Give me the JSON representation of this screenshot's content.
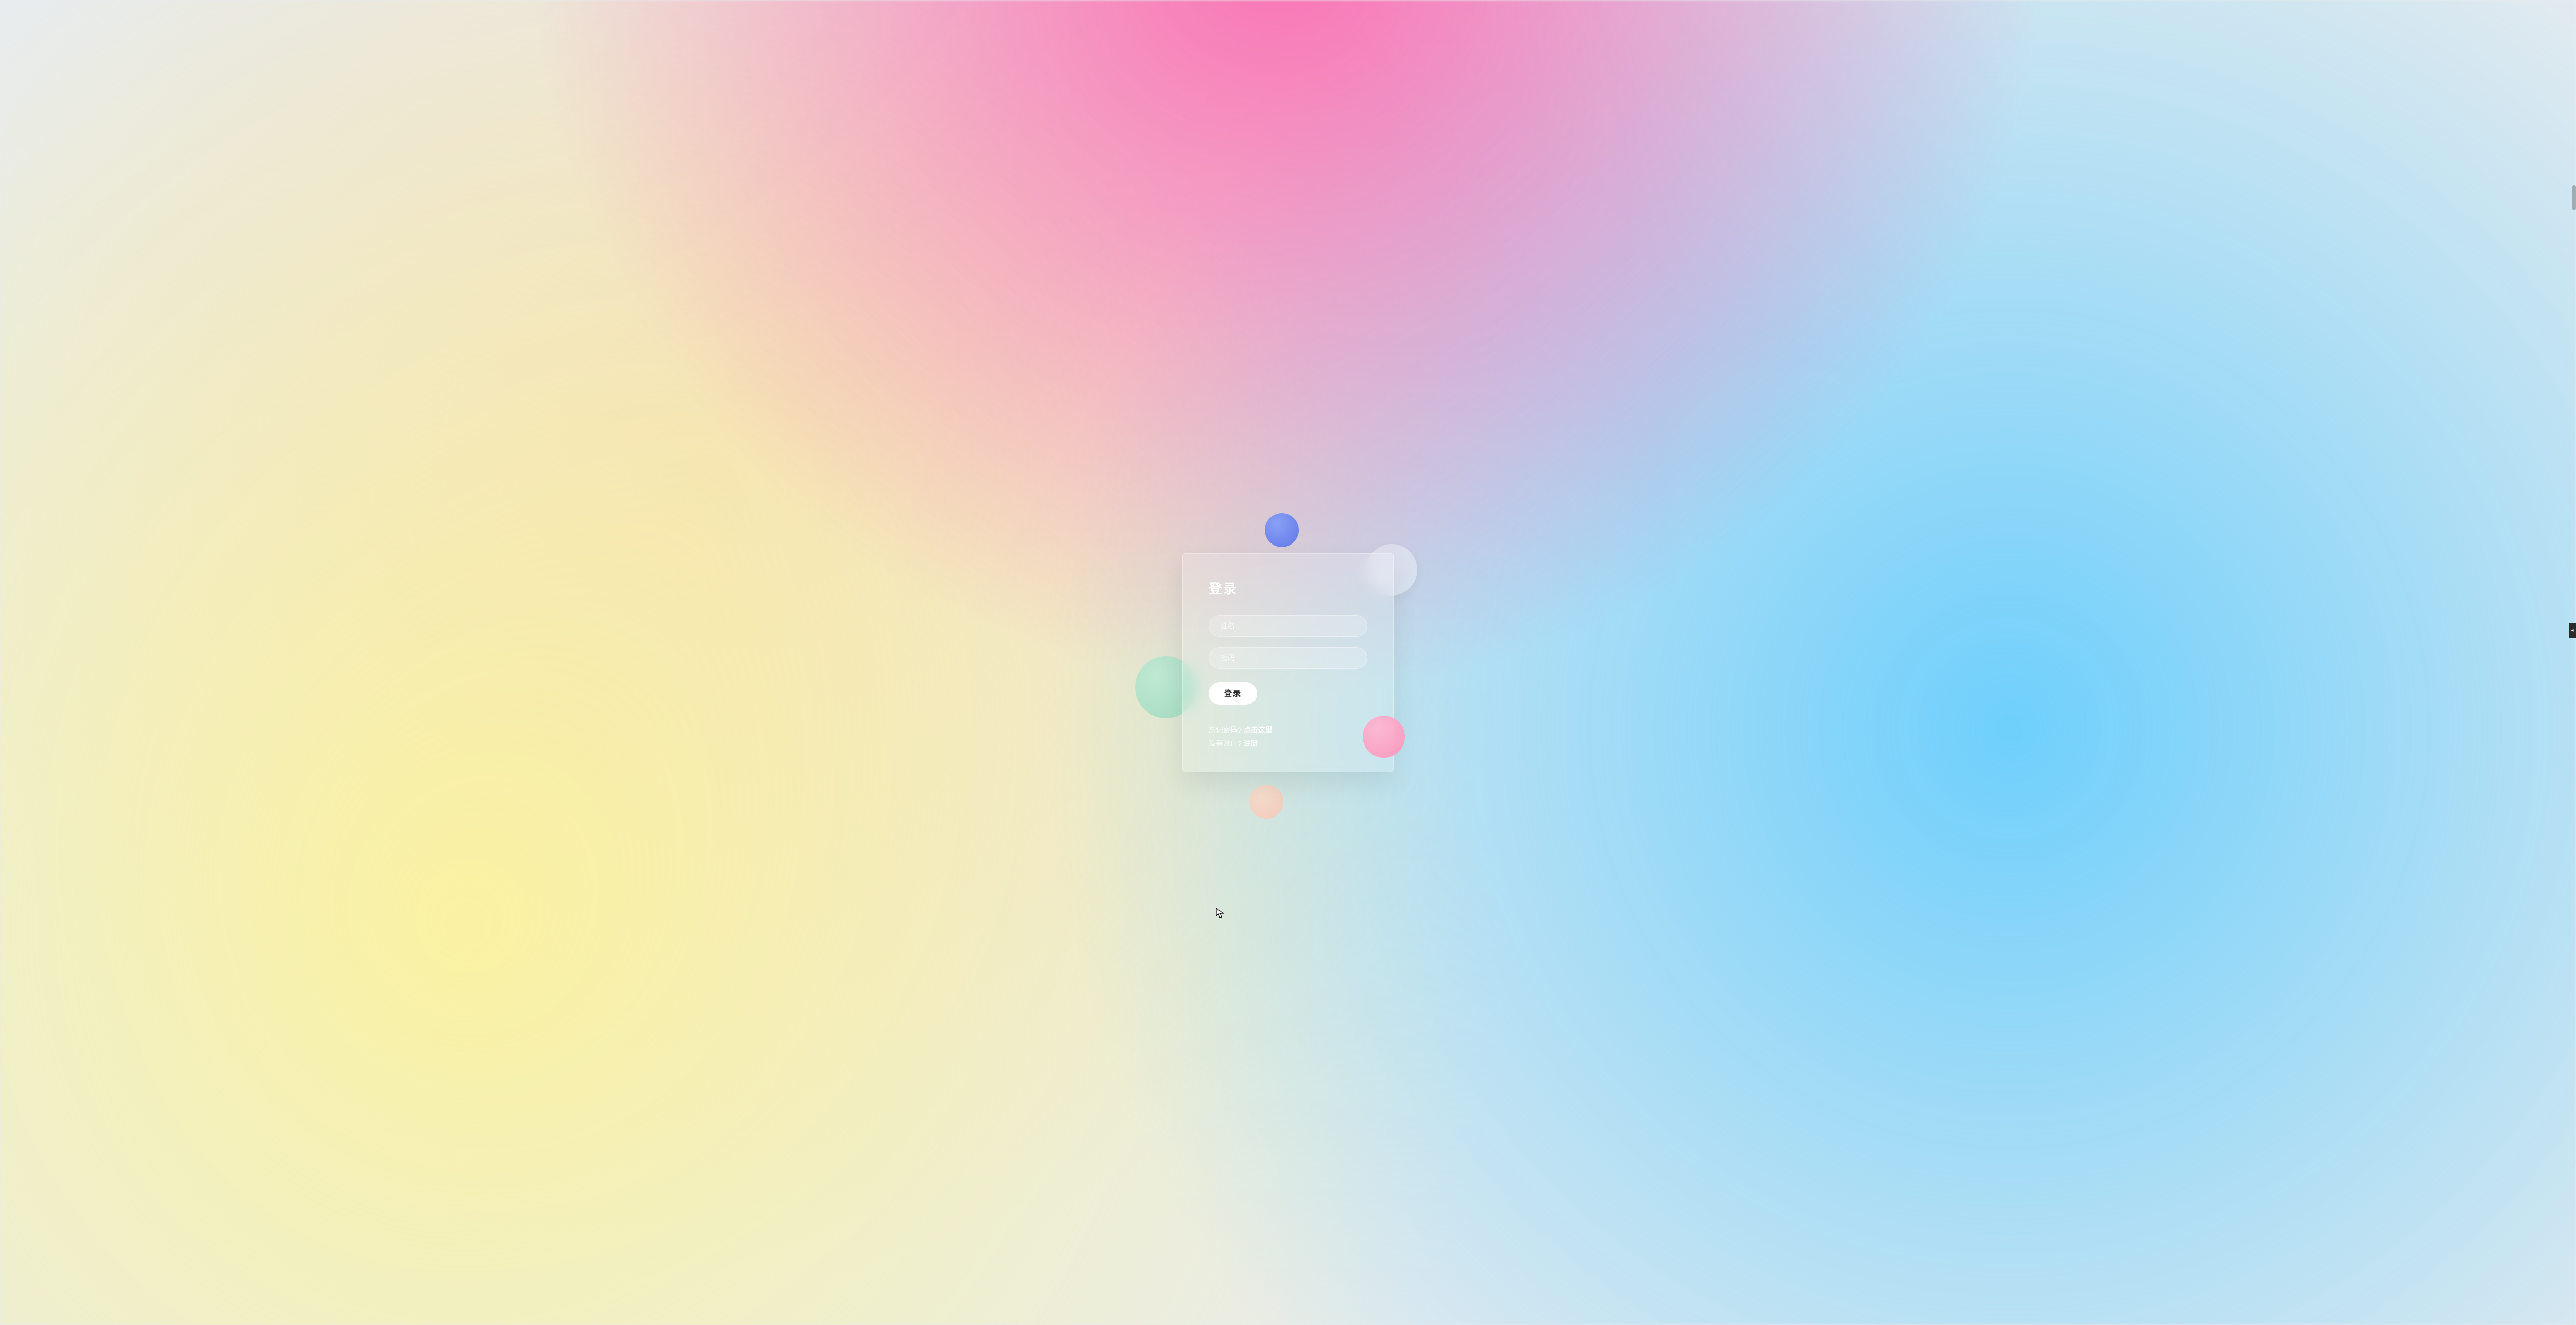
{
  "login": {
    "title": "登录",
    "name_placeholder": "姓名",
    "password_placeholder": "密码",
    "submit_label": "登录",
    "forgot_prompt": "忘记密码? ",
    "forgot_link": "点击这里",
    "noaccount_prompt": "没有账户? ",
    "register_link": "注册"
  },
  "side_tab_glyph": "◂"
}
